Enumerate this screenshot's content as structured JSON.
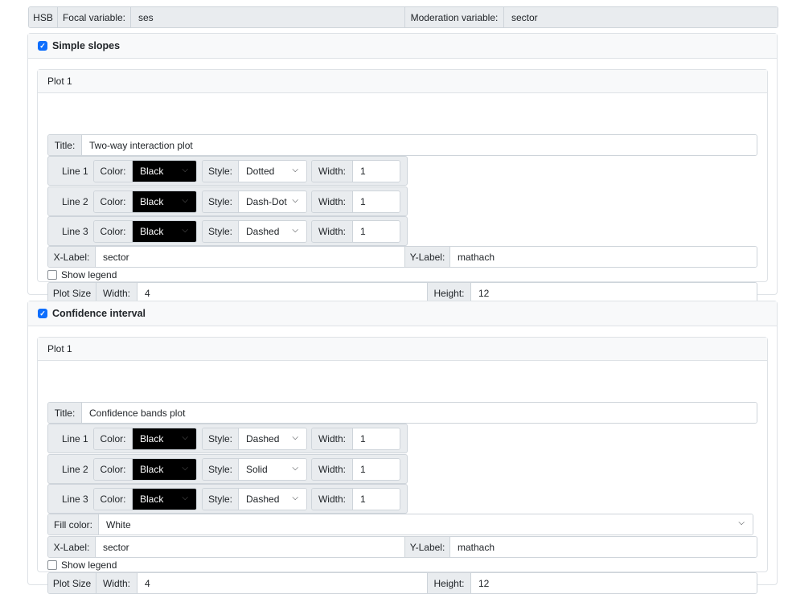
{
  "header": {
    "dataset": "HSB",
    "focal_label": "Focal variable:",
    "focal_value": "ses",
    "moderation_label": "Moderation variable:",
    "moderation_value": "sector"
  },
  "sections": [
    {
      "heading": "Simple slopes",
      "checked": true,
      "plot_heading": "Plot 1",
      "title_label": "Title:",
      "title_value": "Two-way interaction plot",
      "lines": [
        {
          "label": "Line 1",
          "color_label": "Color:",
          "color": "Black",
          "style_label": "Style:",
          "style": "Dotted",
          "width_label": "Width:",
          "width": "1"
        },
        {
          "label": "Line 2",
          "color_label": "Color:",
          "color": "Black",
          "style_label": "Style:",
          "style": "Dash-Dot",
          "width_label": "Width:",
          "width": "1"
        },
        {
          "label": "Line 3",
          "color_label": "Color:",
          "color": "Black",
          "style_label": "Style:",
          "style": "Dashed",
          "width_label": "Width:",
          "width": "1"
        }
      ],
      "xlabel_label": "X-Label:",
      "xlabel": "sector",
      "ylabel_label": "Y-Label:",
      "ylabel": "mathach",
      "show_legend": "Show legend",
      "plot_size_label": "Plot Size",
      "width_label": "Width:",
      "width": "4",
      "height_label": "Height:",
      "height": "12"
    },
    {
      "heading": "Confidence interval",
      "checked": true,
      "plot_heading": "Plot 1",
      "title_label": "Title:",
      "title_value": "Confidence bands plot",
      "lines": [
        {
          "label": "Line 1",
          "color_label": "Color:",
          "color": "Black",
          "style_label": "Style:",
          "style": "Dashed",
          "width_label": "Width:",
          "width": "1"
        },
        {
          "label": "Line 2",
          "color_label": "Color:",
          "color": "Black",
          "style_label": "Style:",
          "style": "Solid",
          "width_label": "Width:",
          "width": "1"
        },
        {
          "label": "Line 3",
          "color_label": "Color:",
          "color": "Black",
          "style_label": "Style:",
          "style": "Dashed",
          "width_label": "Width:",
          "width": "1"
        }
      ],
      "fill_label": "Fill color:",
      "fill": "White",
      "xlabel_label": "X-Label:",
      "xlabel": "sector",
      "ylabel_label": "Y-Label:",
      "ylabel": "mathach",
      "show_legend": "Show legend",
      "plot_size_label": "Plot Size",
      "width_label": "Width:",
      "width": "4",
      "height_label": "Height:",
      "height": "12"
    }
  ],
  "colors": {
    "accent": "#0d6efd",
    "swatch": "#000000"
  }
}
